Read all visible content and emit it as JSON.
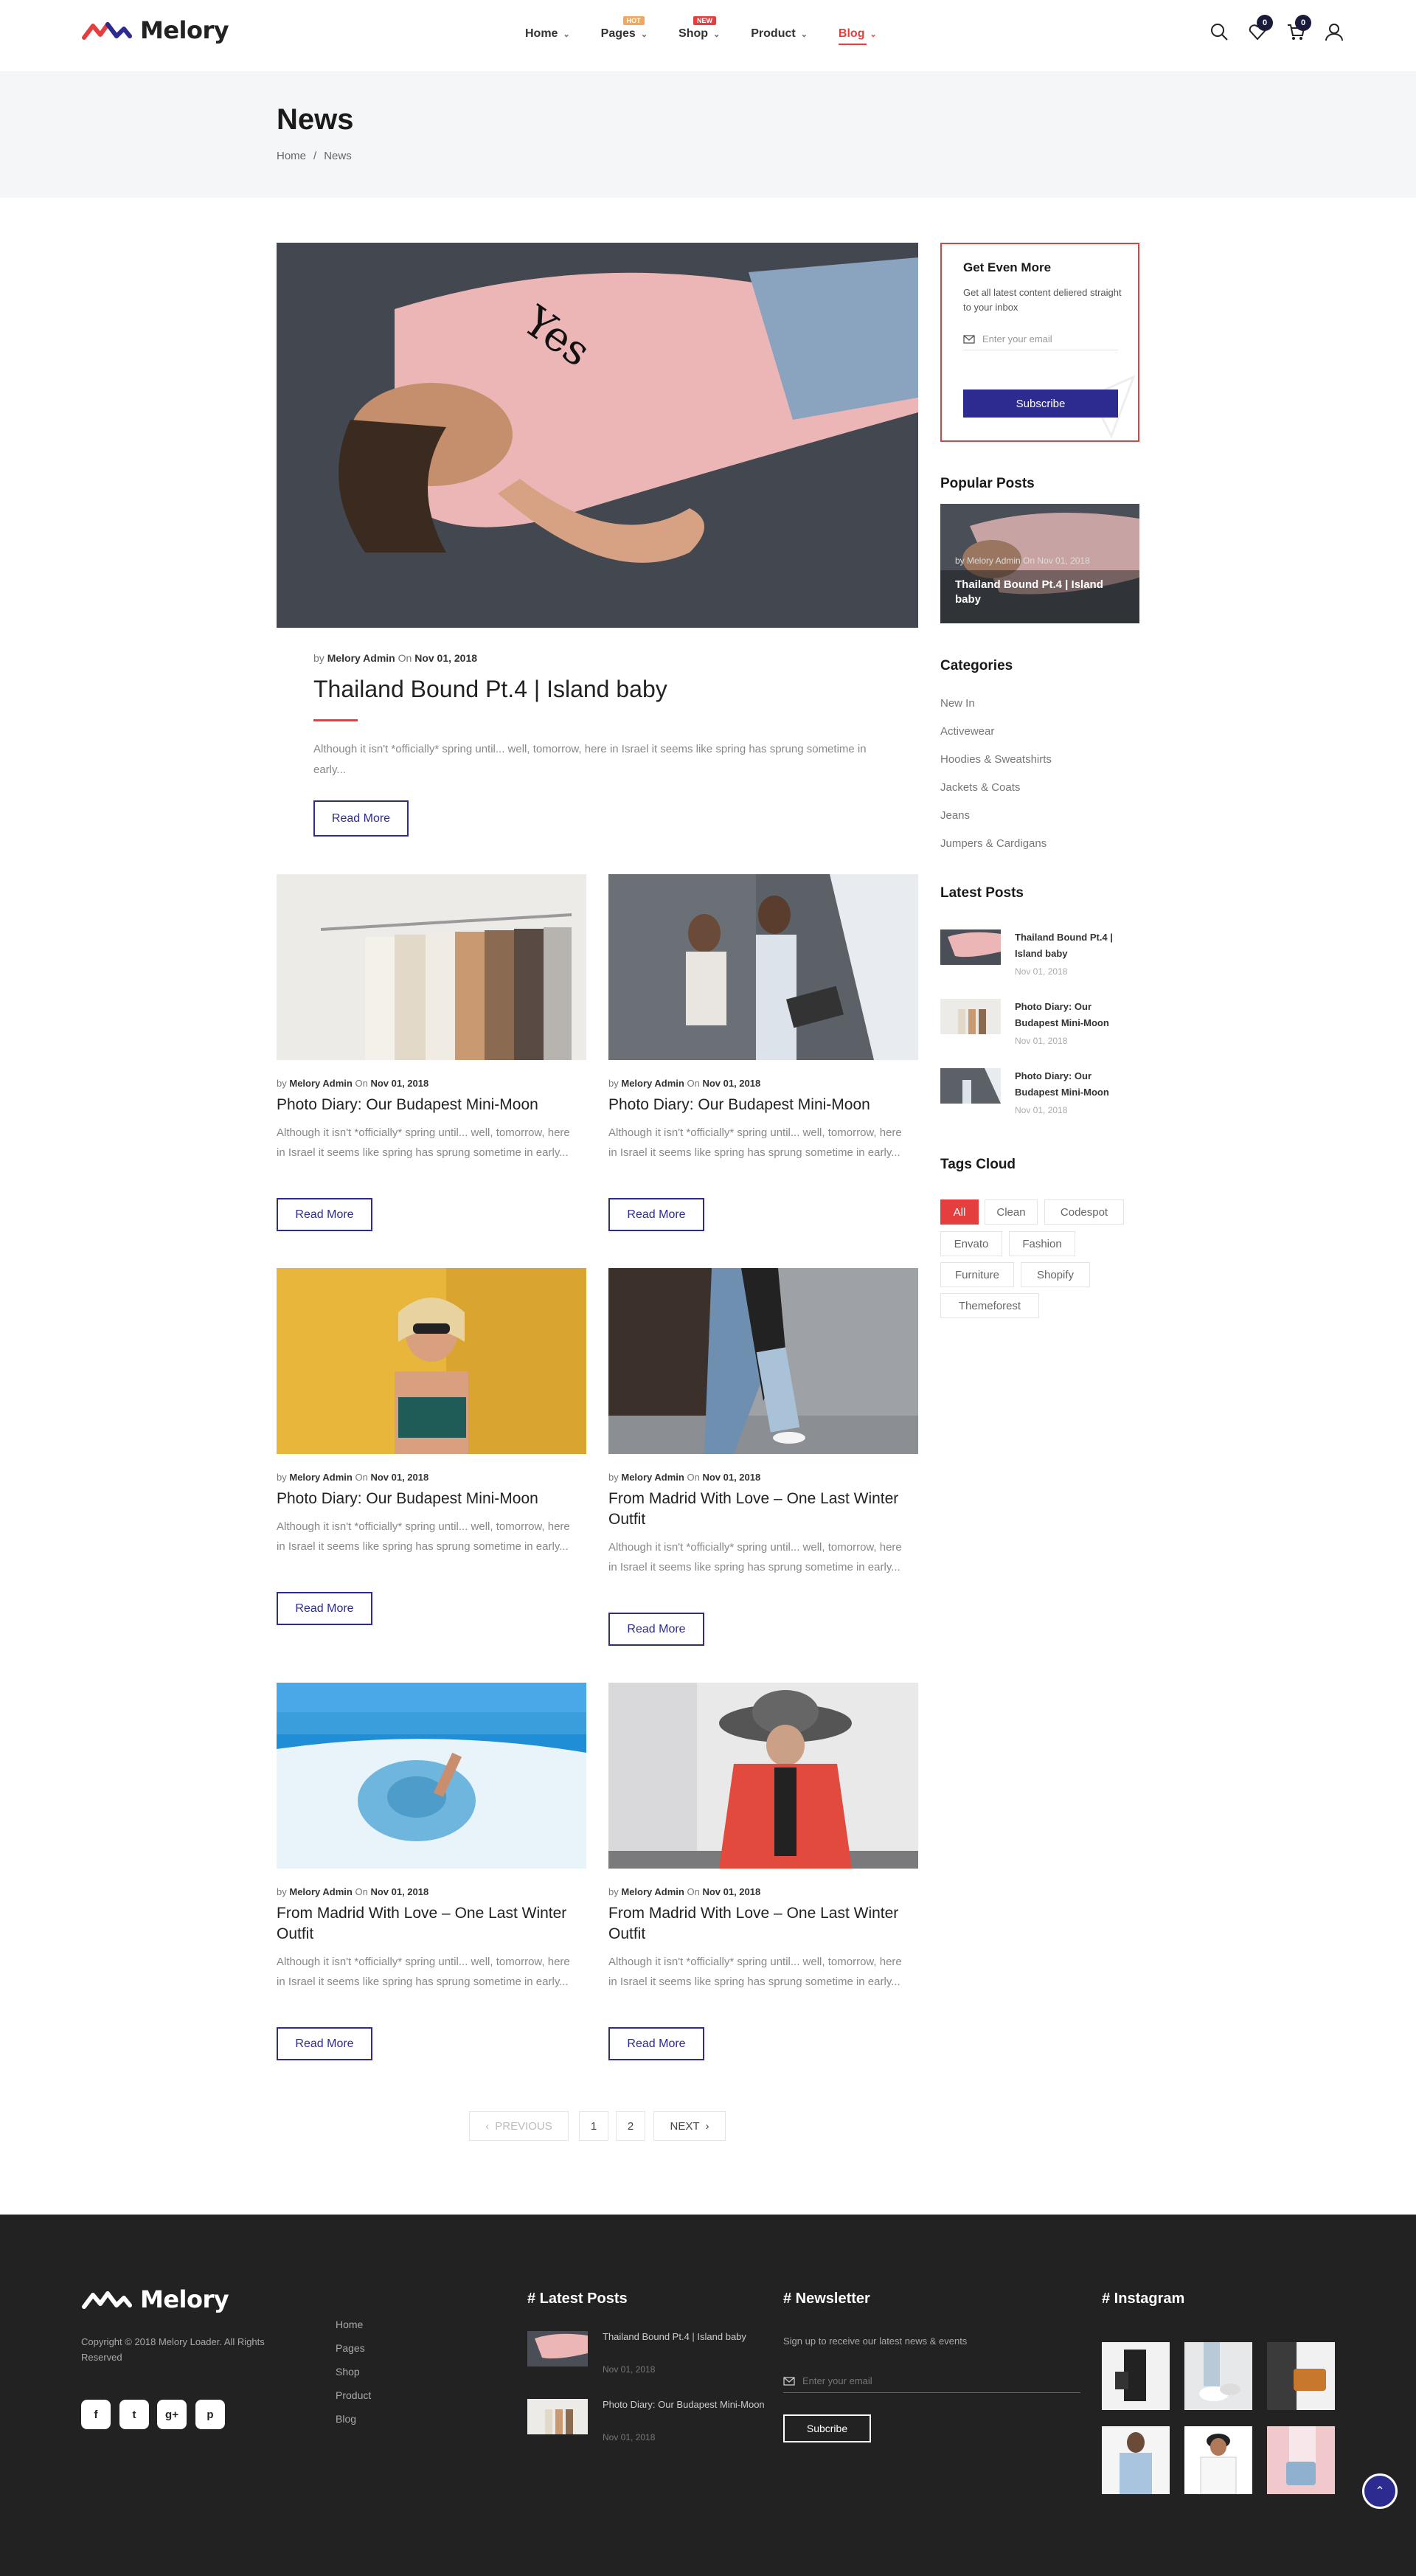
{
  "brand": {
    "name": "Melory"
  },
  "nav": {
    "items": [
      {
        "label": "Home",
        "badge": ""
      },
      {
        "label": "Pages",
        "badge": "HOT"
      },
      {
        "label": "Shop",
        "badge": "NEW"
      },
      {
        "label": "Product",
        "badge": ""
      },
      {
        "label": "Blog",
        "badge": ""
      }
    ],
    "wishlist_count": "0",
    "cart_count": "0"
  },
  "page": {
    "title": "News",
    "breadcrumb": [
      "Home",
      "/",
      "News"
    ]
  },
  "featured": {
    "by": "by",
    "author": "Melory Admin",
    "on": "On",
    "date": "Nov 01, 2018",
    "title": "Thailand Bound Pt.4 | Island baby",
    "excerpt": "Although it isn't *officially* spring until... well, tomorrow, here in Israel it seems like spring has sprung sometime in early...",
    "button": "Read More"
  },
  "posts": [
    {
      "author": "Melory Admin",
      "date": "Nov 01, 2018",
      "title": "Photo Diary: Our Budapest Mini-Moon",
      "excerpt": "Although it isn't *officially* spring until... well, tomorrow, here in Israel it seems like spring has sprung sometime in early...",
      "button": "Read More"
    },
    {
      "author": "Melory Admin",
      "date": "Nov 01, 2018",
      "title": "Photo Diary: Our Budapest Mini-Moon",
      "excerpt": "Although it isn't *officially* spring until... well, tomorrow, here in Israel it seems like spring has sprung sometime in early...",
      "button": "Read More"
    },
    {
      "author": "Melory Admin",
      "date": "Nov 01, 2018",
      "title": "Photo Diary: Our Budapest Mini-Moon",
      "excerpt": "Although it isn't *officially* spring until... well, tomorrow, here in Israel it seems like spring has sprung sometime in early...",
      "button": "Read More"
    },
    {
      "author": "Melory Admin",
      "date": "Nov 01, 2018",
      "title": "From Madrid With Love – One Last Winter Outfit",
      "excerpt": "Although it isn't *officially* spring until... well, tomorrow, here in Israel it seems like spring has sprung sometime in early...",
      "button": "Read More"
    },
    {
      "author": "Melory Admin",
      "date": "Nov 01, 2018",
      "title": "From Madrid With Love – One Last Winter Outfit",
      "excerpt": "Although it isn't *officially* spring until... well, tomorrow, here in Israel it seems like spring has sprung sometime in early...",
      "button": "Read More"
    },
    {
      "author": "Melory Admin",
      "date": "Nov 01, 2018",
      "title": "From Madrid With Love – One Last Winter Outfit",
      "excerpt": "Although it isn't *officially* spring until... well, tomorrow, here in Israel it seems like spring has sprung sometime in early...",
      "button": "Read More"
    }
  ],
  "post_meta_words": {
    "by": "by",
    "on": "On"
  },
  "pagination": {
    "prev": "PREVIOUS",
    "pages": [
      "1",
      "2"
    ],
    "next": "NEXT"
  },
  "sidebar": {
    "subscribe": {
      "title": "Get Even More",
      "text": "Get all latest content deliered straight to your inbox",
      "placeholder": "Enter your email",
      "button": "Subscribe"
    },
    "popular_heading": "Popular Posts",
    "popular": {
      "meta": "by Melory Admin On Nov 01, 2018",
      "title": "Thailand Bound Pt.4 | Island baby"
    },
    "categories_heading": "Categories",
    "categories": [
      "New In",
      "Activewear",
      "Hoodies & Sweatshirts",
      "Jackets & Coats",
      "Jeans",
      "Jumpers & Cardigans"
    ],
    "latest_heading": "Latest Posts",
    "latest": [
      {
        "title": "Thailand Bound Pt.4 | Island baby",
        "date": "Nov 01, 2018"
      },
      {
        "title": "Photo Diary: Our Budapest Mini-Moon",
        "date": "Nov 01, 2018"
      },
      {
        "title": "Photo Diary: Our Budapest Mini-Moon",
        "date": "Nov 01, 2018"
      }
    ],
    "tags_heading": "Tags Cloud",
    "tags": [
      "All",
      "Clean",
      "Codespot",
      "Envato",
      "Fashion",
      "Furniture",
      "Shopify",
      "Themeforest"
    ]
  },
  "footer": {
    "copyright": "Copyright © 2018 Melory Loader. All Rights Reserved",
    "links": [
      "Home",
      "Pages",
      "Shop",
      "Product",
      "Blog"
    ],
    "social": [
      "f",
      "t",
      "g+",
      "p"
    ],
    "latest_heading": "# Latest Posts",
    "latest": [
      {
        "title": "Thailand Bound Pt.4 | Island baby",
        "date": "Nov 01, 2018"
      },
      {
        "title": "Photo Diary: Our Budapest Mini-Moon",
        "date": "Nov 01, 2018"
      }
    ],
    "newsletter_heading": "# Newsletter",
    "newsletter_text": "Sign up to receive our latest news & events",
    "newsletter_placeholder": "Enter your email",
    "newsletter_button": "Subcribe",
    "instagram_heading": "# Instagram"
  },
  "colors": {
    "accent": "#e53e3e",
    "brand_blue": "#2d2b8f",
    "footer_bg": "#222222"
  }
}
